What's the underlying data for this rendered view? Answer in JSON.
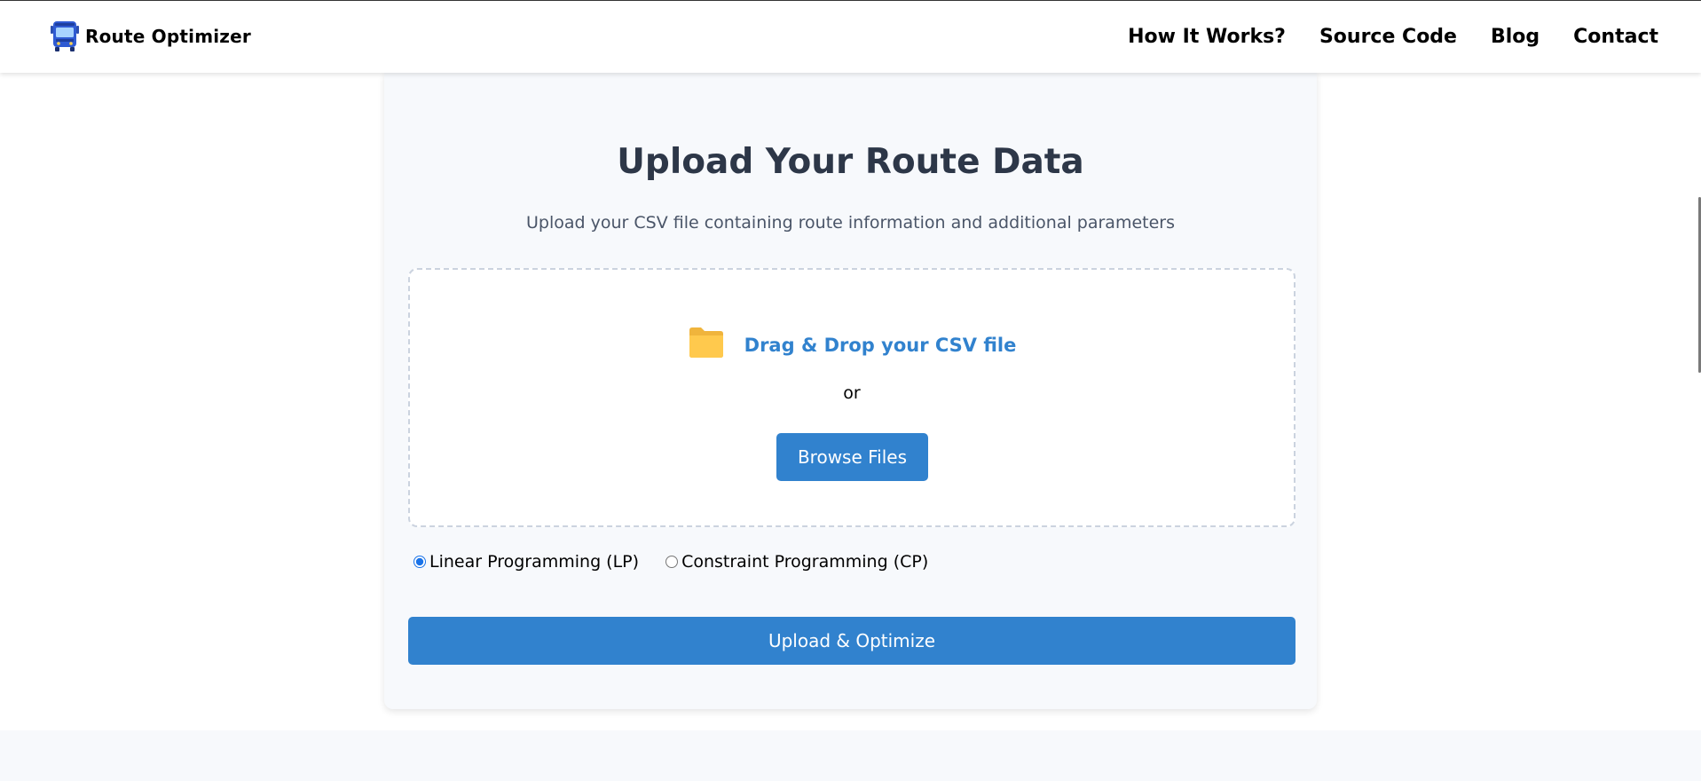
{
  "navbar": {
    "brand_label": "Route Optimizer",
    "brand_icon": "bus-icon",
    "links": [
      {
        "label": "How It Works?"
      },
      {
        "label": "Source Code"
      },
      {
        "label": "Blog"
      },
      {
        "label": "Contact"
      }
    ]
  },
  "upload": {
    "title": "Upload Your Route Data",
    "subtitle": "Upload your CSV file containing route information and additional parameters",
    "dropzone": {
      "icon": "folder-icon",
      "drop_label": "Drag & Drop your CSV file",
      "or_label": "or",
      "browse_label": "Browse Files"
    },
    "methods": [
      {
        "label": "Linear Programming (LP)",
        "value": "lp",
        "selected": true
      },
      {
        "label": "Constraint Programming (CP)",
        "value": "cp",
        "selected": false
      }
    ],
    "submit_label": "Upload & Optimize"
  },
  "colors": {
    "accent": "#3182ce",
    "title": "#2d3748",
    "subtitle": "#4a5568",
    "card_bg": "#f7f9fc"
  }
}
